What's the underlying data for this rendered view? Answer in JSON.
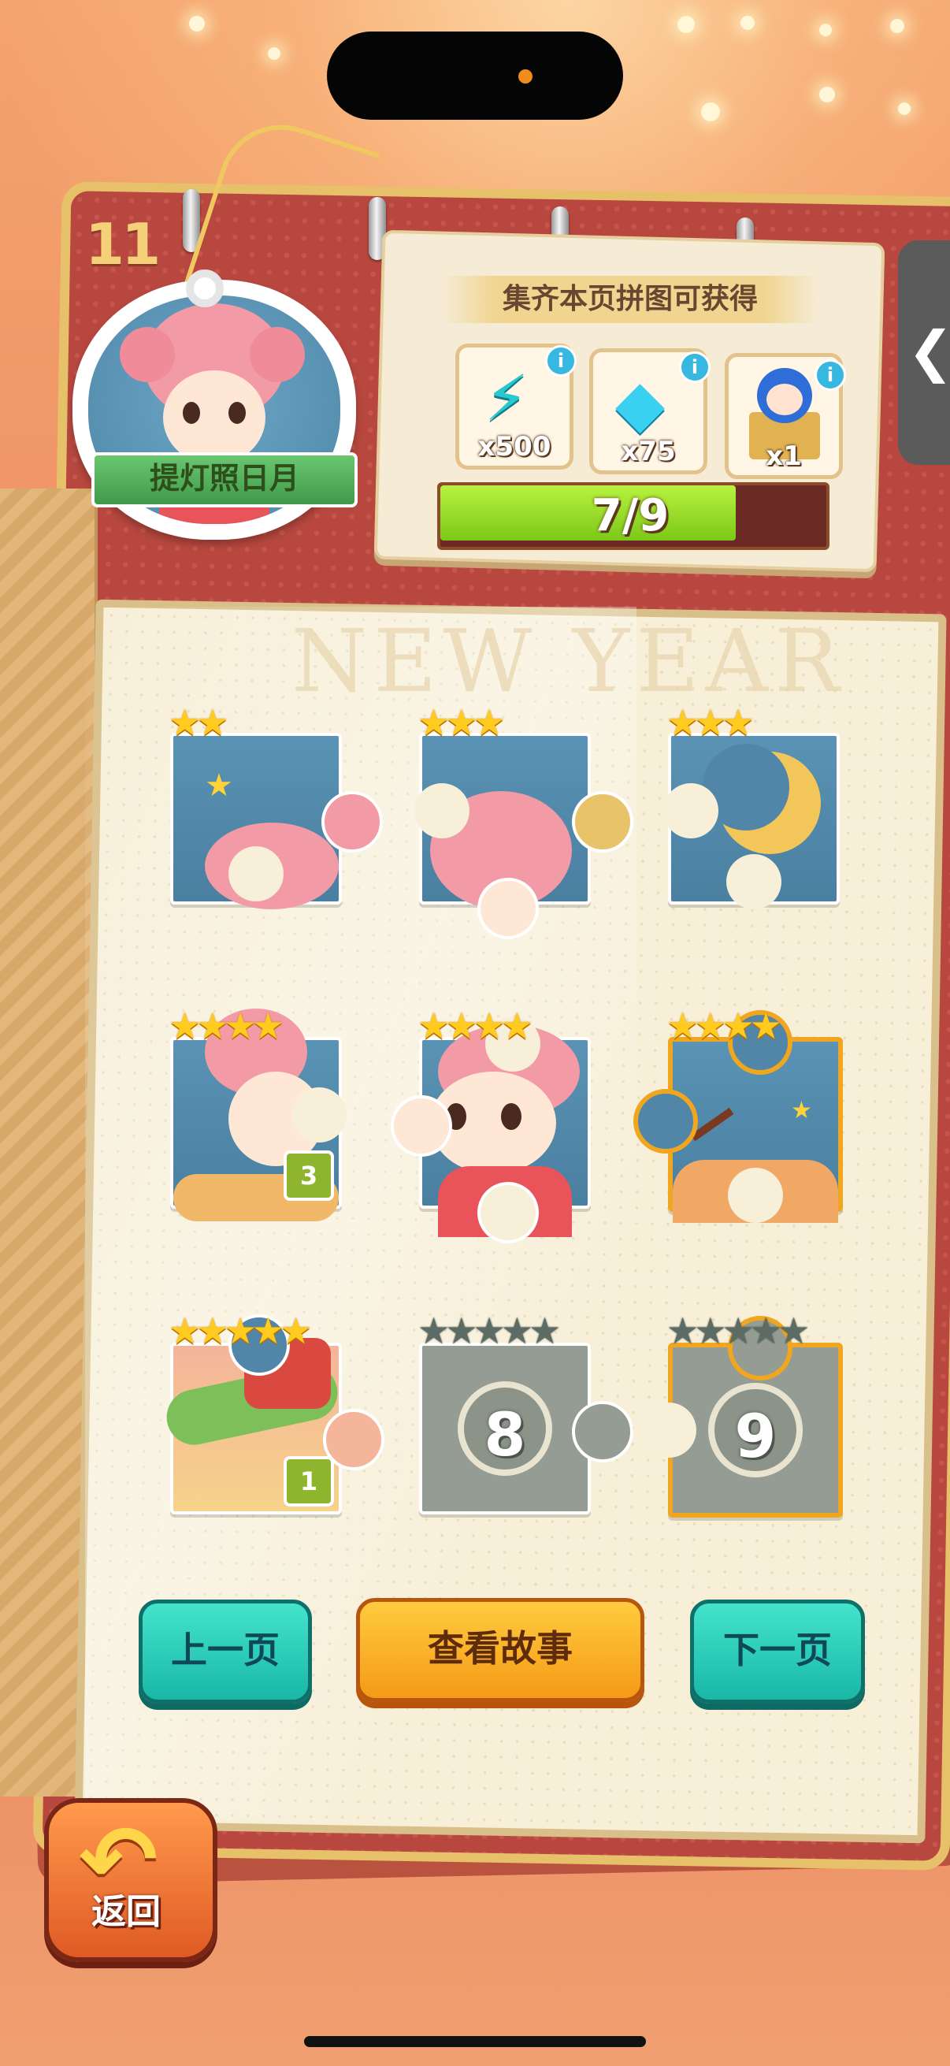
{
  "page_number": "11",
  "character": {
    "name_label": "提灯照日月"
  },
  "reward_panel": {
    "title": "集齐本页拼图可获得",
    "rewards": [
      {
        "icon": "energy-bolt-icon",
        "quantity": "x500"
      },
      {
        "icon": "diamond-icon",
        "quantity": "x75"
      },
      {
        "icon": "character-box-icon",
        "quantity": "x1"
      }
    ],
    "info_glyph": "i",
    "progress": {
      "current": 7,
      "total": 9,
      "text": "7/9"
    }
  },
  "side_tab": {
    "glyph": "❮"
  },
  "background_text": "NEW YEAR",
  "puzzle_pieces": [
    {
      "stars_earned": 2,
      "stars_total": 2,
      "collected": true
    },
    {
      "stars_earned": 3,
      "stars_total": 3,
      "collected": true
    },
    {
      "stars_earned": 3,
      "stars_total": 3,
      "collected": true
    },
    {
      "stars_earned": 4,
      "stars_total": 4,
      "collected": true,
      "count": "3"
    },
    {
      "stars_earned": 4,
      "stars_total": 4,
      "collected": true
    },
    {
      "stars_earned": 4,
      "stars_total": 4,
      "collected": true,
      "highlighted": true
    },
    {
      "stars_earned": 5,
      "stars_total": 5,
      "collected": true,
      "count": "1"
    },
    {
      "stars_earned": 0,
      "stars_total": 5,
      "collected": false,
      "number": "8"
    },
    {
      "stars_earned": 0,
      "stars_total": 5,
      "collected": false,
      "number": "9",
      "highlighted": true
    }
  ],
  "buttons": {
    "prev_label": "上一页",
    "story_label": "查看故事",
    "next_label": "下一页",
    "back_label": "返回"
  },
  "colors": {
    "background": "#ee8f63",
    "progress_fill": "#9ee02c",
    "teal_button": "#2fd0bb",
    "orange_button": "#f7ad22",
    "star_gold": "#ffcb1f",
    "piece_blue": "#5286a8",
    "piece_locked": "#949c93"
  }
}
